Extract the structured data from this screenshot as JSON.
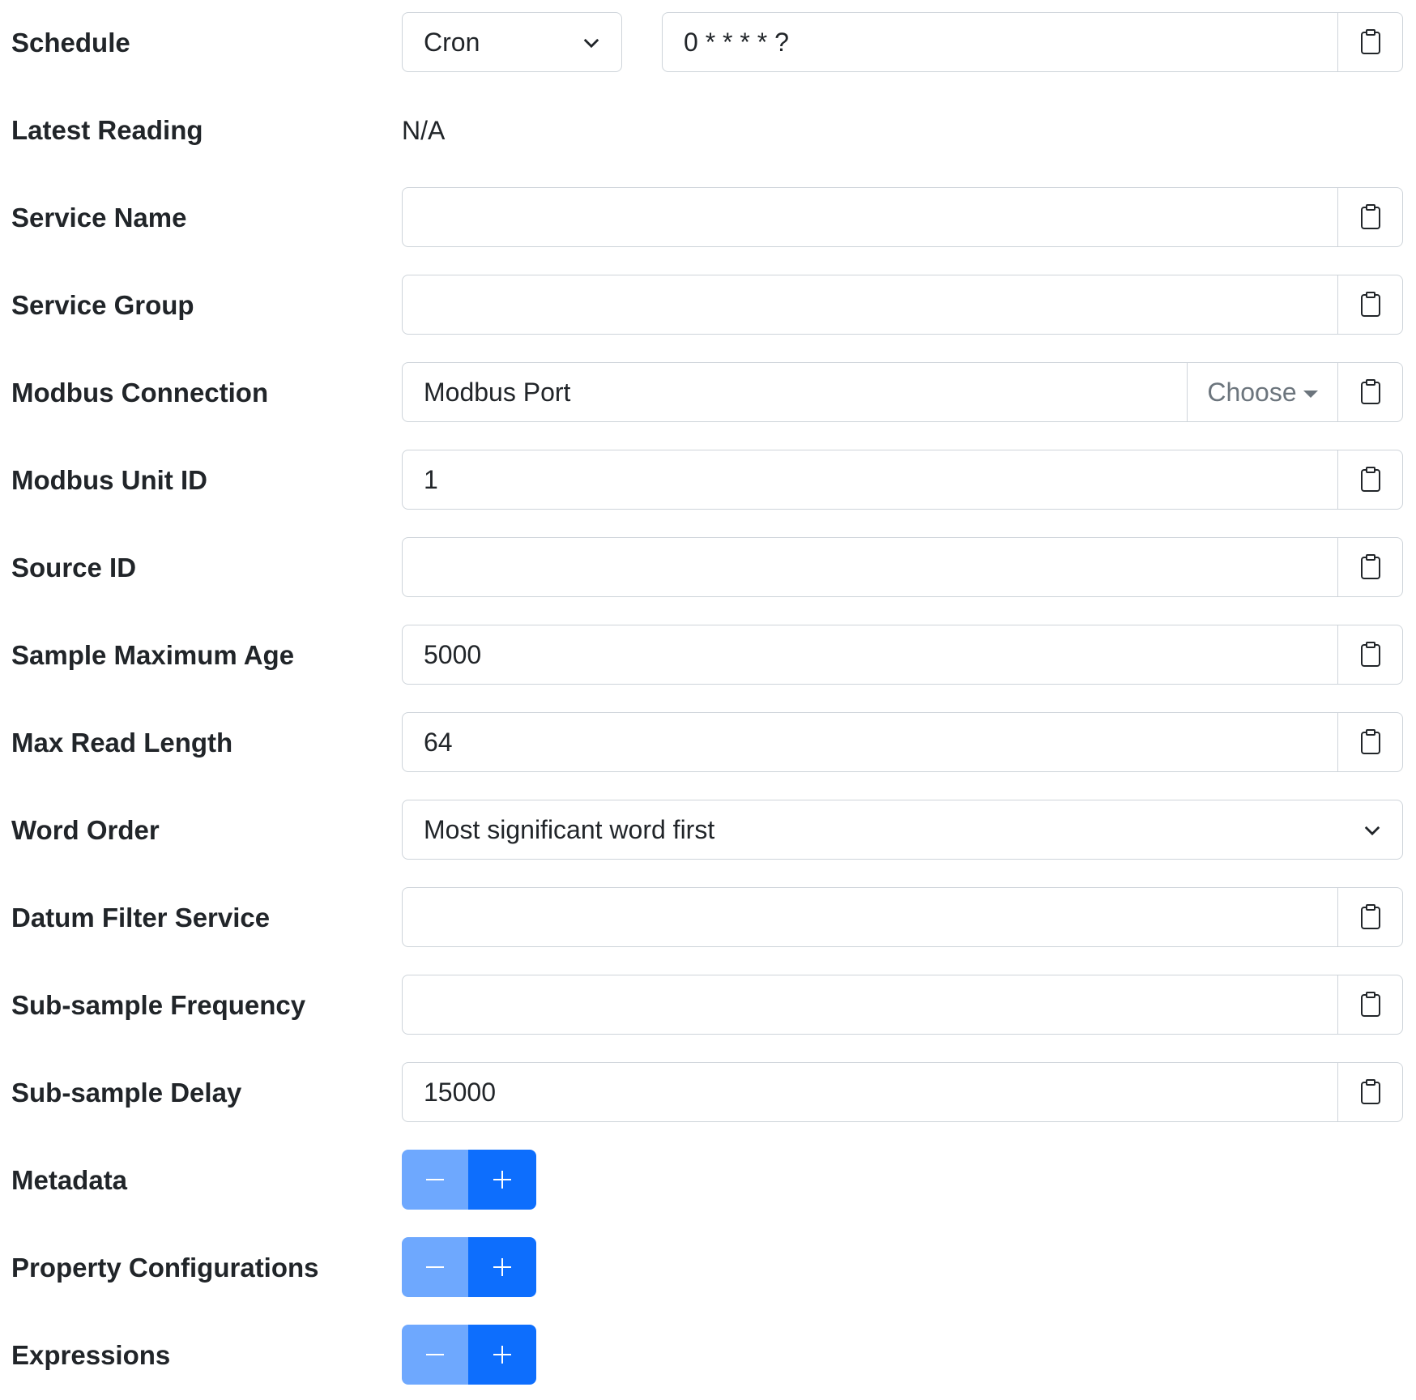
{
  "schedule": {
    "label": "Schedule",
    "type_value": "Cron",
    "cron_value": "0 * * * * ?"
  },
  "latest_reading": {
    "label": "Latest Reading",
    "value": "N/A"
  },
  "service_name": {
    "label": "Service Name",
    "value": ""
  },
  "service_group": {
    "label": "Service Group",
    "value": ""
  },
  "modbus_connection": {
    "label": "Modbus Connection",
    "value": "Modbus Port",
    "choose_label": "Choose"
  },
  "modbus_unit_id": {
    "label": "Modbus Unit ID",
    "value": "1"
  },
  "source_id": {
    "label": "Source ID",
    "value": ""
  },
  "sample_max_age": {
    "label": "Sample Maximum Age",
    "value": "5000"
  },
  "max_read_length": {
    "label": "Max Read Length",
    "value": "64"
  },
  "word_order": {
    "label": "Word Order",
    "value": "Most significant word first"
  },
  "datum_filter_service": {
    "label": "Datum Filter Service",
    "value": ""
  },
  "sub_sample_frequency": {
    "label": "Sub-sample Frequency",
    "value": ""
  },
  "sub_sample_delay": {
    "label": "Sub-sample Delay",
    "value": "15000"
  },
  "metadata": {
    "label": "Metadata"
  },
  "property_configurations": {
    "label": "Property Configurations"
  },
  "expressions": {
    "label": "Expressions"
  },
  "colors": {
    "primary": "#0d6efd",
    "primary_light": "#6ea8fe",
    "border": "#ced4da",
    "text": "#212529",
    "muted": "#6c757d"
  },
  "icons": {
    "copy": "clipboard-icon",
    "dropdown": "chevron-down-icon",
    "decrement": "minus-icon",
    "increment": "plus-icon"
  }
}
